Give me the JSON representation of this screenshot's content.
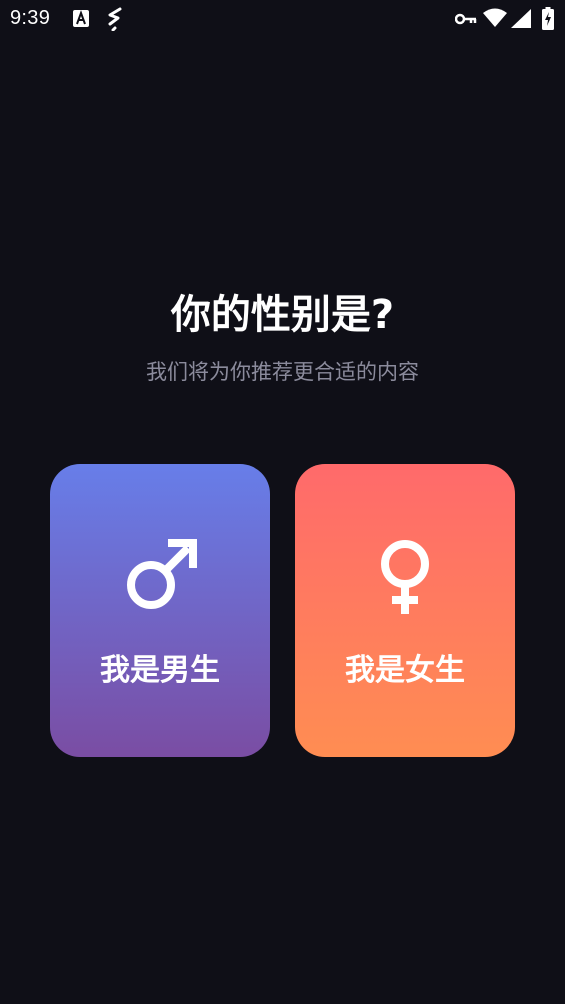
{
  "status_bar": {
    "time": "9:39",
    "icons": [
      "font-a-icon",
      "data-saver-icon",
      "vpn-key-icon",
      "wifi-icon",
      "cell-signal-icon",
      "battery-charging-icon"
    ]
  },
  "header": {
    "title": "你的性别是?",
    "subtitle": "我们将为你推荐更合适的内容"
  },
  "options": [
    {
      "label": "我是男生",
      "icon": "male-symbol-icon",
      "gradient": [
        "#677ee9",
        "#7a4da3"
      ]
    },
    {
      "label": "我是女生",
      "icon": "female-symbol-icon",
      "gradient": [
        "#ff6a6b",
        "#ff8d52"
      ]
    }
  ],
  "colors": {
    "background": "#0f0f17",
    "subtitle": "#8b8b9c",
    "text": "#ffffff"
  }
}
